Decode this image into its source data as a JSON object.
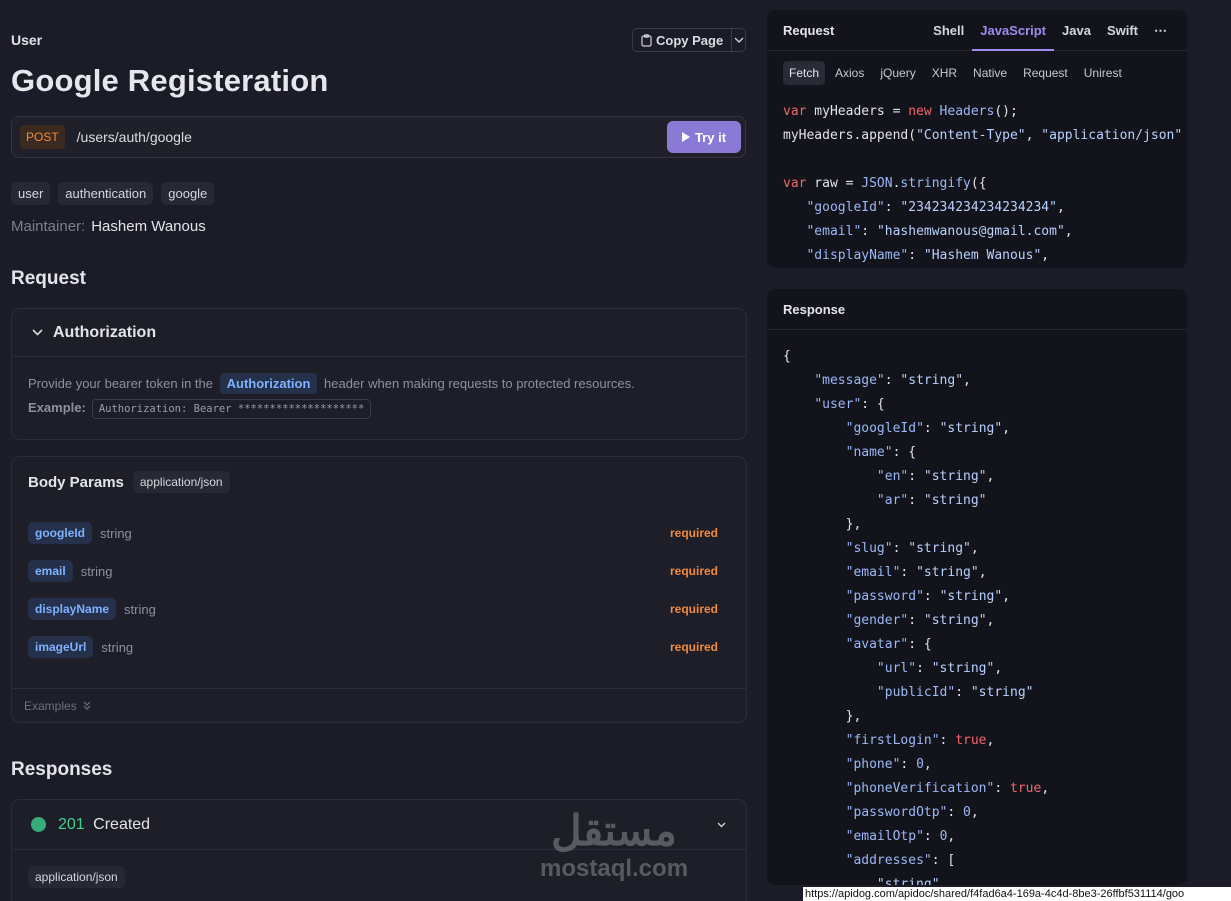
{
  "breadcrumb": "User",
  "copy_page_label": "Copy Page",
  "title": "Google Registeration",
  "endpoint": {
    "method": "POST",
    "path": "/users/auth/google",
    "try_label": "Try it"
  },
  "tags": [
    "user",
    "authentication",
    "google"
  ],
  "maintainer": {
    "label": "Maintainer:",
    "name": "Hashem Wanous"
  },
  "request_heading": "Request",
  "authorization": {
    "title": "Authorization",
    "text_before": "Provide your bearer token in the",
    "chip": "Authorization",
    "text_after": "header when making requests to protected resources.",
    "example_label": "Example:",
    "example_value": "Authorization: Bearer ********************"
  },
  "body_params": {
    "title": "Body Params",
    "content_type": "application/json",
    "params": [
      {
        "name": "googleId",
        "type": "string",
        "required": "required"
      },
      {
        "name": "email",
        "type": "string",
        "required": "required"
      },
      {
        "name": "displayName",
        "type": "string",
        "required": "required"
      },
      {
        "name": "imageUrl",
        "type": "string",
        "required": "required"
      }
    ],
    "examples_label": "Examples"
  },
  "responses": {
    "heading": "Responses",
    "code": "201",
    "status": "Created",
    "content_type": "application/json"
  },
  "request_panel": {
    "title": "Request",
    "languages": [
      "Shell",
      "JavaScript",
      "Java",
      "Swift"
    ],
    "active_language": "JavaScript",
    "subtabs": [
      "Fetch",
      "Axios",
      "jQuery",
      "XHR",
      "Native",
      "Request",
      "Unirest"
    ],
    "active_subtab": "Fetch"
  },
  "response_panel": {
    "title": "Response"
  },
  "watermark": {
    "arabic": "مستقل",
    "latin": "mostaql.com"
  },
  "status_url": "https://apidog.com/apidoc/shared/f4fad6a4-169a-4c4d-8be3-26ffbf531114/goo"
}
